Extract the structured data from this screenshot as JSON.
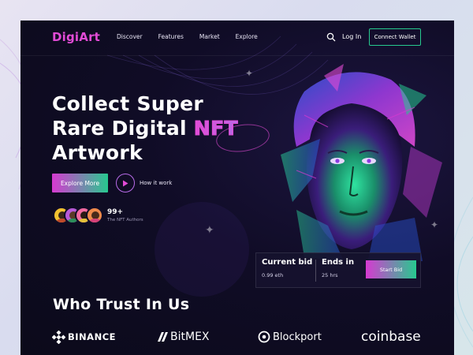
{
  "brand": {
    "logo": "DigiArt",
    "accent": "#e24bd6",
    "accent2": "#27c98f"
  },
  "nav": {
    "links": [
      "Discover",
      "Features",
      "Market",
      "Explore"
    ],
    "login": "Log In",
    "connect_wallet": "Connect Wallet",
    "search_icon": "search-icon"
  },
  "hero": {
    "title_line1": "Collect Super",
    "title_line2_prefix": "Rare Digital ",
    "title_highlight": "NFT",
    "title_line3": "Artwork",
    "explore_button": "Explore More",
    "how_it_works": "How it work",
    "authors_count": "99+",
    "authors_label": "The NFT Authors"
  },
  "bid": {
    "current_bid_label": "Current bid",
    "current_bid_value": "0.99 eth",
    "ends_in_label": "Ends in",
    "ends_in_value": "25 hrs",
    "start_bid_button": "Start Bid"
  },
  "trust": {
    "title": "Who Trust In Us",
    "partners": [
      "BINANCE",
      "BitMEX",
      "Blockport",
      "coinbase"
    ]
  }
}
